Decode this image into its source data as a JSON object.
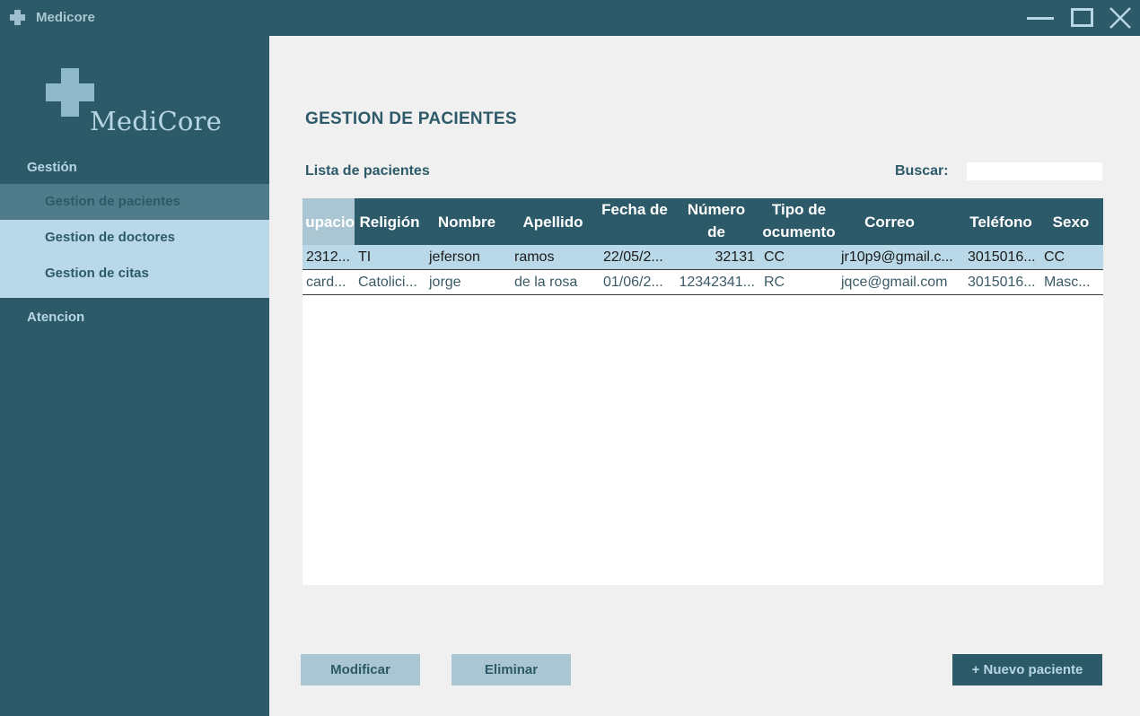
{
  "window": {
    "title": "Medicore",
    "minimize_icon": "minimize-icon",
    "maximize_icon": "maximize-icon",
    "close_icon": "close-icon"
  },
  "sidebar": {
    "logo_text": "MediCore",
    "sections": [
      {
        "title": "Gestión",
        "items": [
          {
            "label": "Gestion de pacientes",
            "active": true
          },
          {
            "label": "Gestion de doctores",
            "active": false
          },
          {
            "label": "Gestion de citas",
            "active": false
          }
        ]
      },
      {
        "title": "Atencion",
        "items": []
      }
    ]
  },
  "main": {
    "page_title": "GESTION DE PACIENTES",
    "list_title": "Lista de pacientes",
    "search_label": "Buscar:",
    "search_value": "",
    "table": {
      "columns": [
        "upacio",
        "Religión",
        "Nombre",
        "Apellido",
        "Fecha de",
        "Número de",
        "Tipo de ocumento",
        "Correo",
        "Teléfono",
        "Sexo"
      ],
      "rows": [
        [
          "2312...",
          "TI",
          "jeferson",
          "ramos",
          "22/05/2...",
          "32131",
          "CC",
          "jr10p9@gmail.c...",
          "3015016...",
          "CC"
        ],
        [
          "card...",
          "Catolici...",
          "jorge",
          "de la rosa",
          "01/06/2...",
          "12342341...",
          "RC",
          "jqce@gmail.com",
          "3015016...",
          "Masc..."
        ]
      ],
      "selected_row": 0
    },
    "buttons": {
      "modify": "Modificar",
      "delete": "Eliminar",
      "new_patient": "+ Nuevo paciente"
    }
  },
  "colors": {
    "primary": "#2d5a68",
    "light": "#bad9e8",
    "accent": "#a9c6d2",
    "background": "#f0f0f0"
  }
}
